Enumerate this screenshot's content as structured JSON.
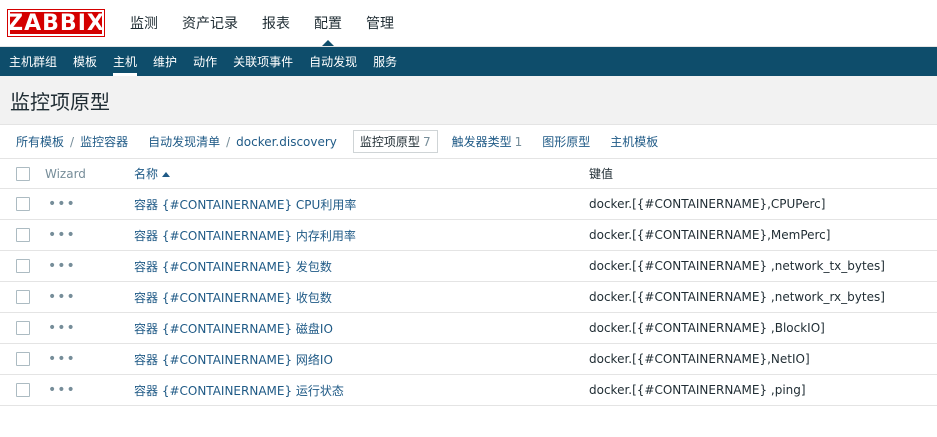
{
  "logo": "ZABBIX",
  "top_menu": [
    {
      "label": "监测",
      "active": false
    },
    {
      "label": "资产记录",
      "active": false
    },
    {
      "label": "报表",
      "active": false
    },
    {
      "label": "配置",
      "active": true
    },
    {
      "label": "管理",
      "active": false
    }
  ],
  "sub_menu": [
    {
      "label": "主机群组",
      "active": false
    },
    {
      "label": "模板",
      "active": false
    },
    {
      "label": "主机",
      "active": true
    },
    {
      "label": "维护",
      "active": false
    },
    {
      "label": "动作",
      "active": false
    },
    {
      "label": "关联项事件",
      "active": false
    },
    {
      "label": "自动发现",
      "active": false
    },
    {
      "label": "服务",
      "active": false
    }
  ],
  "page_title": "监控项原型",
  "breadcrumbs": {
    "all_templates": "所有模板",
    "container": "监控容器",
    "discovery_list": "自动发现清单",
    "discovery": "docker.discovery",
    "active_tab": {
      "label": "监控项原型",
      "count": "7"
    },
    "trigger_proto": {
      "label": "触发器类型",
      "count": "1"
    },
    "graph_proto": "图形原型",
    "host_proto": "主机模板",
    "separator": "/"
  },
  "table": {
    "headers": {
      "wizard": "Wizard",
      "name": "名称",
      "key": "键值"
    },
    "wizard_glyph": "•••",
    "rows": [
      {
        "name": "容器 {#CONTAINERNAME} CPU利用率",
        "key": "docker.[{#CONTAINERNAME},CPUPerc]"
      },
      {
        "name": "容器 {#CONTAINERNAME} 内存利用率",
        "key": "docker.[{#CONTAINERNAME},MemPerc]"
      },
      {
        "name": "容器 {#CONTAINERNAME} 发包数",
        "key": "docker.[{#CONTAINERNAME} ,network_tx_bytes]"
      },
      {
        "name": "容器 {#CONTAINERNAME} 收包数",
        "key": "docker.[{#CONTAINERNAME} ,network_rx_bytes]"
      },
      {
        "name": "容器 {#CONTAINERNAME} 磁盘IO",
        "key": "docker.[{#CONTAINERNAME} ,BlockIO]"
      },
      {
        "name": "容器 {#CONTAINERNAME} 网络IO",
        "key": "docker.[{#CONTAINERNAME},NetIO]"
      },
      {
        "name": "容器 {#CONTAINERNAME} 运行状态",
        "key": "docker.[{#CONTAINERNAME} ,ping]"
      }
    ]
  },
  "colors": {
    "brand": "#d40000",
    "nav": "#0e4d6b",
    "link": "#1f5a86"
  }
}
